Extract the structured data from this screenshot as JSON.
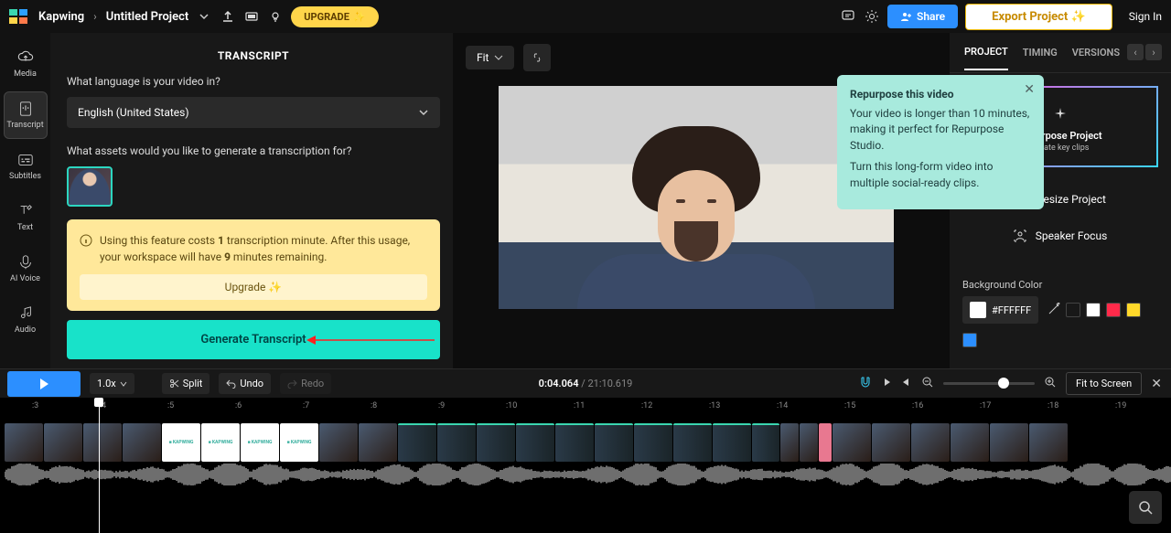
{
  "topbar": {
    "app_name": "Kapwing",
    "project_name": "Untitled Project",
    "upgrade": "UPGRADE",
    "share": "Share",
    "export": "Export Project",
    "signin": "Sign In"
  },
  "leftrail": {
    "media": "Media",
    "transcript": "Transcript",
    "subtitles": "Subtitles",
    "text": "Text",
    "aivoice": "AI Voice",
    "audio": "Audio"
  },
  "panel": {
    "title": "TRANSCRIPT",
    "lang_label": "What language is your video in?",
    "lang_value": "English (United States)",
    "assets_label": "What assets would you like to generate a transcription for?",
    "cost_text_1": "Using this feature costs ",
    "cost_bold_1": "1",
    "cost_text_2": " transcription minute. After this usage, your workspace will have ",
    "cost_bold_2": "9",
    "cost_text_3": " minutes remaining.",
    "cost_upgrade": "Upgrade ✨",
    "generate": "Generate Transcript"
  },
  "canvas": {
    "fit": "Fit"
  },
  "popover": {
    "title": "Repurpose this video",
    "p1": "Your video is longer than 10 minutes, making it perfect for Repurpose Studio.",
    "p2": "Turn this long-form video into multiple social-ready clips."
  },
  "right": {
    "tab_project": "PROJECT",
    "tab_timing": "TIMING",
    "tab_versions": "VERSIONS",
    "repurpose_title": "Repurpose Project",
    "repurpose_sub": "Create key clips",
    "resize": "Resize Project",
    "speaker": "Speaker Focus",
    "bgcolor_label": "Background Color",
    "bgcolor_value": "#FFFFFF"
  },
  "bottom": {
    "speed": "1.0x",
    "split": "Split",
    "undo": "Undo",
    "redo": "Redo",
    "time_cur": "0:04.064",
    "time_tot": "21:10.619",
    "fit_screen": "Fit to Screen"
  },
  "swatches": {
    "c1": "#000000",
    "c2": "#ffffff",
    "c3": "#ff2a4a",
    "c4": "#ffd82a",
    "c5": "#2c8fff"
  },
  "ruler": [
    ":3",
    ":4",
    ":5",
    ":6",
    ":7",
    ":8",
    ":9",
    ":10",
    ":11",
    ":12",
    ":13",
    ":14",
    ":15",
    ":16",
    ":17",
    ":18",
    ":19"
  ]
}
